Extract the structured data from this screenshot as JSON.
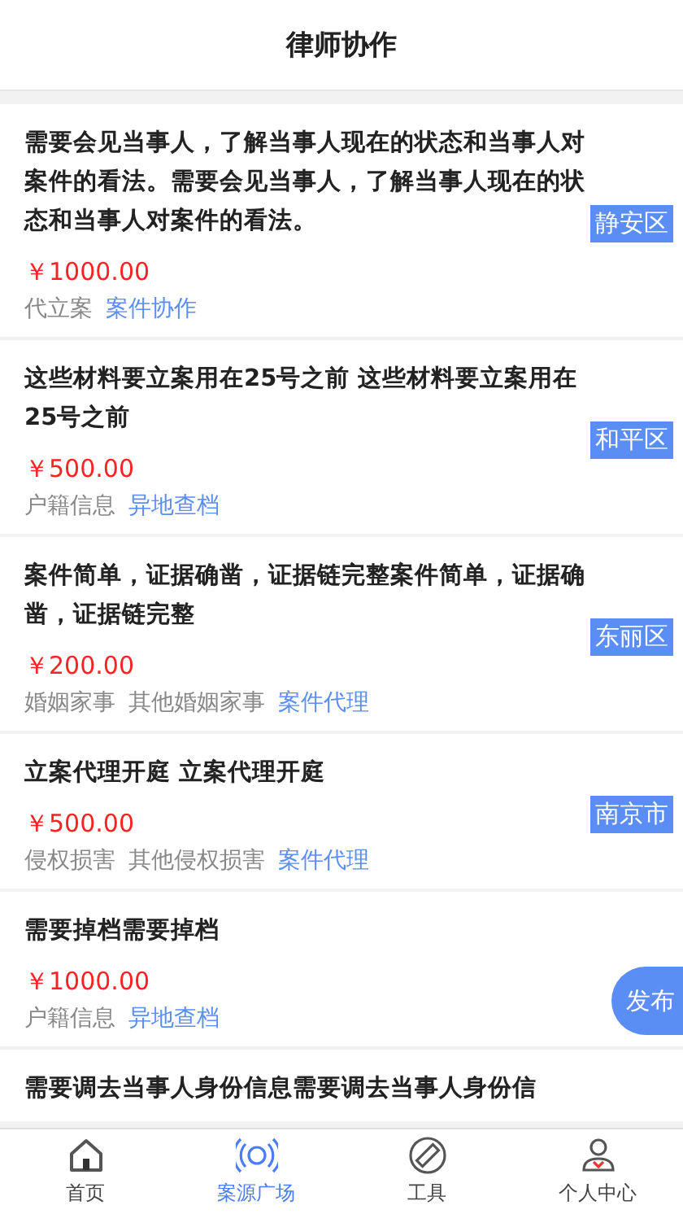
{
  "header": {
    "title": "律师协作"
  },
  "cases": [
    {
      "title": "需要会见当事人，了解当事人现在的状态和当事人对案件的看法。需要会见当事人，了解当事人现在的状态和当事人对案件的看法。",
      "price": "￥1000.00",
      "tags": [
        {
          "text": "代立案",
          "kind": "category"
        },
        {
          "text": "案件协作",
          "kind": "type"
        }
      ],
      "region": "静安区"
    },
    {
      "title": "这些材料要立案用在25号之前 这些材料要立案用在25号之前",
      "price": "￥500.00",
      "tags": [
        {
          "text": "户籍信息",
          "kind": "category"
        },
        {
          "text": "异地查档",
          "kind": "type"
        }
      ],
      "region": "和平区"
    },
    {
      "title": "案件简单，证据确凿，证据链完整案件简单，证据确凿，证据链完整",
      "price": "￥200.00",
      "tags": [
        {
          "text": "婚姻家事",
          "kind": "category"
        },
        {
          "text": "其他婚姻家事",
          "kind": "category"
        },
        {
          "text": "案件代理",
          "kind": "type"
        }
      ],
      "region": "东丽区"
    },
    {
      "title": "立案代理开庭 立案代理开庭",
      "price": "￥500.00",
      "tags": [
        {
          "text": "侵权损害",
          "kind": "category"
        },
        {
          "text": "其他侵权损害",
          "kind": "category"
        },
        {
          "text": "案件代理",
          "kind": "type"
        }
      ],
      "region": "南京市"
    },
    {
      "title": "需要掉档需要掉档",
      "price": "￥1000.00",
      "tags": [
        {
          "text": "户籍信息",
          "kind": "category"
        },
        {
          "text": "异地查档",
          "kind": "type"
        }
      ]
    },
    {
      "title": "需要调去当事人身份信息需要调去当事人身份信"
    }
  ],
  "publish_button": {
    "label": "发布"
  },
  "nav": [
    {
      "label": "首页",
      "selected": false
    },
    {
      "label": "案源广场",
      "selected": true
    },
    {
      "label": "工具",
      "selected": false
    },
    {
      "label": "个人中心",
      "selected": false
    }
  ]
}
